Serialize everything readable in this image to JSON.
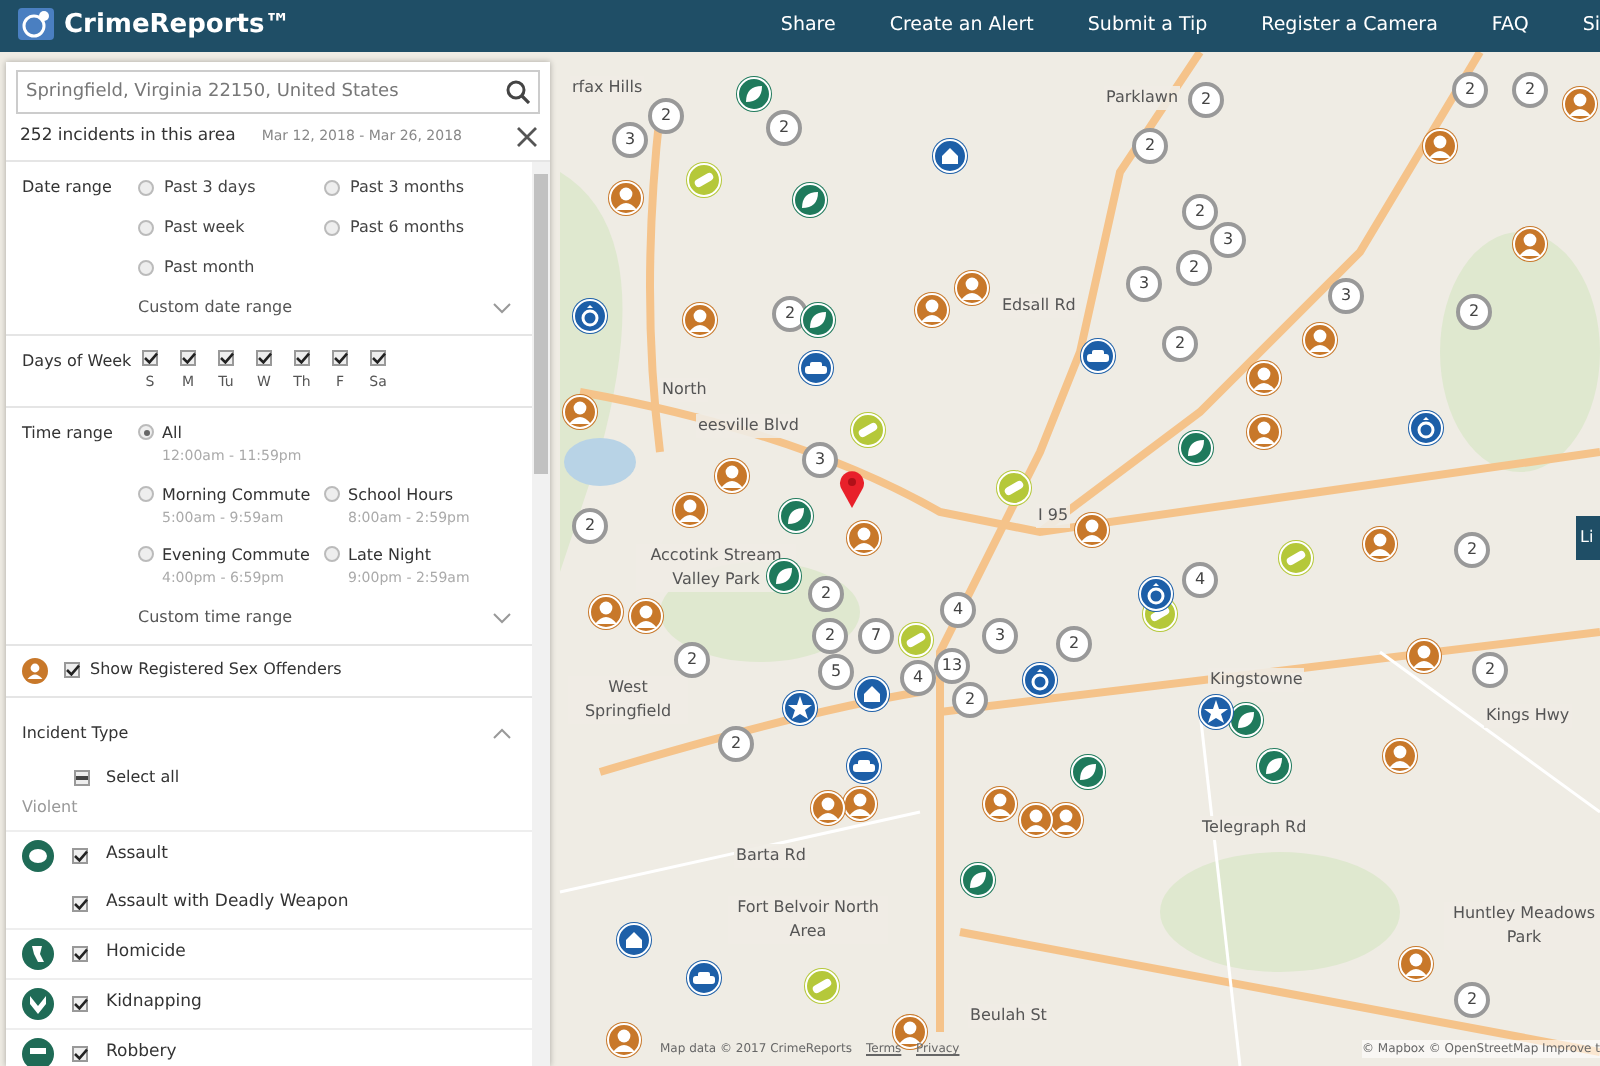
{
  "navbar": {
    "brand": "CrimeReports™",
    "links": [
      "Share",
      "Create an Alert",
      "Submit a Tip",
      "Register a Camera",
      "FAQ",
      "Si"
    ]
  },
  "search": {
    "value": "Springfield, Virginia 22150, United States"
  },
  "summary": {
    "count": "252 incidents in this area",
    "dates": "Mar 12, 2018 - Mar 26, 2018"
  },
  "date_range": {
    "label": "Date range",
    "options": [
      {
        "label": "Past 3 days",
        "selected": false
      },
      {
        "label": "Past 3 months",
        "selected": false
      },
      {
        "label": "Past week",
        "selected": false
      },
      {
        "label": "Past 6 months",
        "selected": false
      },
      {
        "label": "Past month",
        "selected": false
      }
    ],
    "custom": "Custom date range"
  },
  "days_of_week": {
    "label": "Days of Week",
    "days": [
      {
        "label": "S",
        "checked": true
      },
      {
        "label": "M",
        "checked": true
      },
      {
        "label": "Tu",
        "checked": true
      },
      {
        "label": "W",
        "checked": true
      },
      {
        "label": "Th",
        "checked": true
      },
      {
        "label": "F",
        "checked": true
      },
      {
        "label": "Sa",
        "checked": true
      }
    ]
  },
  "time_range": {
    "label": "Time range",
    "options": [
      {
        "label": "All",
        "hours": "12:00am - 11:59pm",
        "selected": true
      },
      {
        "label": "Morning Commute",
        "hours": "5:00am - 9:59am",
        "selected": false
      },
      {
        "label": "School Hours",
        "hours": "8:00am - 2:59pm",
        "selected": false
      },
      {
        "label": "Evening Commute",
        "hours": "4:00pm - 6:59pm",
        "selected": false
      },
      {
        "label": "Late Night",
        "hours": "9:00pm - 2:59am",
        "selected": false
      }
    ],
    "custom": "Custom time range"
  },
  "offenders": {
    "label": "Show Registered Sex Offenders",
    "checked": true
  },
  "incident_type": {
    "label": "Incident Type",
    "expanded": true,
    "select_all": {
      "label": "Select all",
      "indeterminate": true
    },
    "group": "Violent",
    "items": [
      {
        "label": "Assault",
        "checked": true,
        "kind": "assault"
      },
      {
        "label": "Assault with Deadly Weapon",
        "checked": true,
        "kind": "plain"
      },
      {
        "label": "Homicide",
        "checked": true,
        "kind": "homicide"
      },
      {
        "label": "Kidnapping",
        "checked": true,
        "kind": "kidnapping"
      },
      {
        "label": "Robbery",
        "checked": true,
        "kind": "robbery"
      }
    ]
  },
  "map": {
    "labels": [
      "rfax Hills",
      "Parklawn",
      "Edsall Rd",
      "eesville Blvd",
      "North",
      "Accotink Stream Valley Park",
      "West Springfield",
      "I 95",
      "Kingstowne",
      "Kings Hwy",
      "Barta Rd",
      "Fort Belvoir North Area",
      "Huntley Meadows Park",
      "Telegraph Rd",
      "Beulah St"
    ],
    "markers": [
      {
        "kind": "cluster",
        "label": "3"
      },
      {
        "kind": "cluster",
        "label": "2"
      },
      {
        "kind": "cluster",
        "label": "2"
      },
      {
        "kind": "cluster",
        "label": "2"
      },
      {
        "kind": "cluster",
        "label": "2"
      },
      {
        "kind": "cluster",
        "label": "2"
      },
      {
        "kind": "cluster",
        "label": "2"
      },
      {
        "kind": "cluster",
        "label": "2"
      },
      {
        "kind": "cluster",
        "label": "3"
      },
      {
        "kind": "cluster",
        "label": "2"
      },
      {
        "kind": "cluster",
        "label": "3"
      },
      {
        "kind": "cluster",
        "label": "2"
      },
      {
        "kind": "cluster",
        "label": "2"
      },
      {
        "kind": "cluster",
        "label": "3"
      },
      {
        "kind": "cluster",
        "label": "2"
      },
      {
        "kind": "cluster",
        "label": "2"
      },
      {
        "kind": "cluster",
        "label": "2"
      },
      {
        "kind": "cluster",
        "label": "7"
      },
      {
        "kind": "cluster",
        "label": "4"
      },
      {
        "kind": "cluster",
        "label": "13"
      },
      {
        "kind": "cluster",
        "label": "4"
      },
      {
        "kind": "cluster",
        "label": "3"
      },
      {
        "kind": "cluster",
        "label": "2"
      },
      {
        "kind": "cluster",
        "label": "5"
      },
      {
        "kind": "cluster",
        "label": "2"
      },
      {
        "kind": "cluster",
        "label": "2"
      },
      {
        "kind": "cluster",
        "label": "2"
      },
      {
        "kind": "cluster",
        "label": "2"
      },
      {
        "kind": "cluster",
        "label": "4"
      },
      {
        "kind": "cluster",
        "label": "2"
      },
      {
        "kind": "cluster",
        "label": "2"
      },
      {
        "kind": "cluster",
        "label": "3"
      },
      {
        "kind": "cluster",
        "label": "2"
      },
      {
        "kind": "offender"
      },
      {
        "kind": "offender"
      },
      {
        "kind": "offender"
      },
      {
        "kind": "offender"
      },
      {
        "kind": "offender"
      },
      {
        "kind": "offender"
      },
      {
        "kind": "offender"
      },
      {
        "kind": "offender"
      },
      {
        "kind": "offender"
      },
      {
        "kind": "offender"
      },
      {
        "kind": "offender"
      },
      {
        "kind": "offender"
      },
      {
        "kind": "offender"
      },
      {
        "kind": "offender"
      },
      {
        "kind": "offender"
      },
      {
        "kind": "offender"
      },
      {
        "kind": "offender"
      },
      {
        "kind": "offender"
      },
      {
        "kind": "offender"
      },
      {
        "kind": "offender"
      },
      {
        "kind": "offender"
      },
      {
        "kind": "offender"
      },
      {
        "kind": "offender"
      },
      {
        "kind": "offender"
      },
      {
        "kind": "offender"
      },
      {
        "kind": "offender"
      },
      {
        "kind": "offender"
      },
      {
        "kind": "offender"
      },
      {
        "kind": "theft"
      },
      {
        "kind": "theft"
      },
      {
        "kind": "theft"
      },
      {
        "kind": "theft"
      },
      {
        "kind": "theft"
      },
      {
        "kind": "theft"
      },
      {
        "kind": "theft"
      },
      {
        "kind": "theft"
      },
      {
        "kind": "theft"
      },
      {
        "kind": "theft"
      },
      {
        "kind": "vandalism"
      },
      {
        "kind": "vandalism"
      },
      {
        "kind": "vandalism"
      },
      {
        "kind": "vandalism"
      },
      {
        "kind": "vandalism"
      },
      {
        "kind": "vandalism"
      },
      {
        "kind": "vandalism"
      },
      {
        "kind": "burglary"
      },
      {
        "kind": "burglary"
      },
      {
        "kind": "burglary"
      },
      {
        "kind": "vehicle"
      },
      {
        "kind": "vehicle"
      },
      {
        "kind": "vehicle"
      },
      {
        "kind": "vehicle"
      },
      {
        "kind": "ring"
      },
      {
        "kind": "ring"
      },
      {
        "kind": "ring"
      },
      {
        "kind": "ring"
      },
      {
        "kind": "star"
      },
      {
        "kind": "star"
      },
      {
        "kind": "pin"
      }
    ],
    "side_tab": "Li",
    "attribution": "Map data © 2017 CrimeReports",
    "terms": "Terms",
    "privacy": "Privacy",
    "credits": "© Mapbox © OpenStreetMap Improve t"
  }
}
